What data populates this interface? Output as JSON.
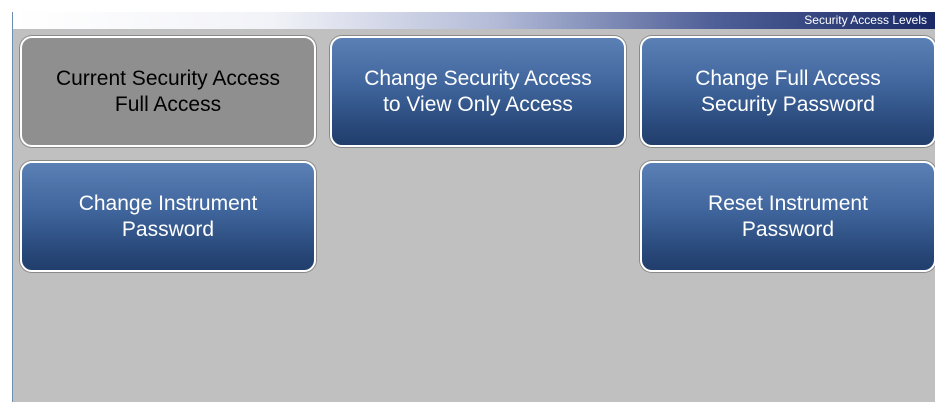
{
  "header": {
    "title": "Security Access Levels"
  },
  "tiles": {
    "current": {
      "line1": "Current Security Access",
      "line2": "Full Access"
    },
    "view_only": {
      "line1": "Change Security Access",
      "line2": "to View Only Access"
    },
    "full_password": {
      "line1": "Change Full Access",
      "line2": "Security Password"
    },
    "instrument_password": {
      "line1": "Change Instrument",
      "line2": "Password"
    },
    "reset_password": {
      "line1": "Reset Instrument",
      "line2": "Password"
    }
  },
  "colors": {
    "background": "#c0c0c0",
    "button_blue": "#3f659c",
    "button_disabled": "#8f8f8f",
    "title_bar_dark": "#1a2a66"
  }
}
